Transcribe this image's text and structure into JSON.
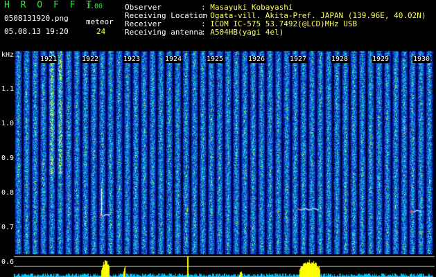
{
  "app": {
    "title": "H R O F F T",
    "version": "1.00",
    "filename": "0508131920.png",
    "datetime": "05.08.13 19:20",
    "meteor_label": "meteor",
    "meteor_count": "24"
  },
  "info": [
    {
      "label": "Observer",
      "value": ": Masayuki Kobayashi"
    },
    {
      "label": "Receiving Location",
      "value": ": Ogata-vill. Akita-Pref. JAPAN (139.96E, 40.02N)"
    },
    {
      "label": "Receiver",
      "value": ": ICOM IC-575 53.7492(@LCD)MHz USB"
    },
    {
      "label": "Receiving antenna",
      "value": ": A504HB(yagi 4el)"
    }
  ],
  "axis": {
    "unit": "kHz",
    "y_ticks": [
      "1.1",
      "1.0",
      "0.9",
      "0.8",
      "0.7",
      "0.6"
    ],
    "time_ticks": [
      "1921",
      "1922",
      "1923",
      "1924",
      "1925",
      "1926",
      "1927",
      "1928",
      "1929",
      "1930"
    ]
  },
  "colors": {
    "background": "#000000",
    "spectrum_base": "#0a1a8a",
    "signal_low": "#1a5cff",
    "signal_mid": "#19c8c8",
    "signal_high": "#ffff00",
    "meteor_echo": "#ff4060",
    "level_bar": "#00c8ff",
    "level_peak": "#ffff00"
  }
}
